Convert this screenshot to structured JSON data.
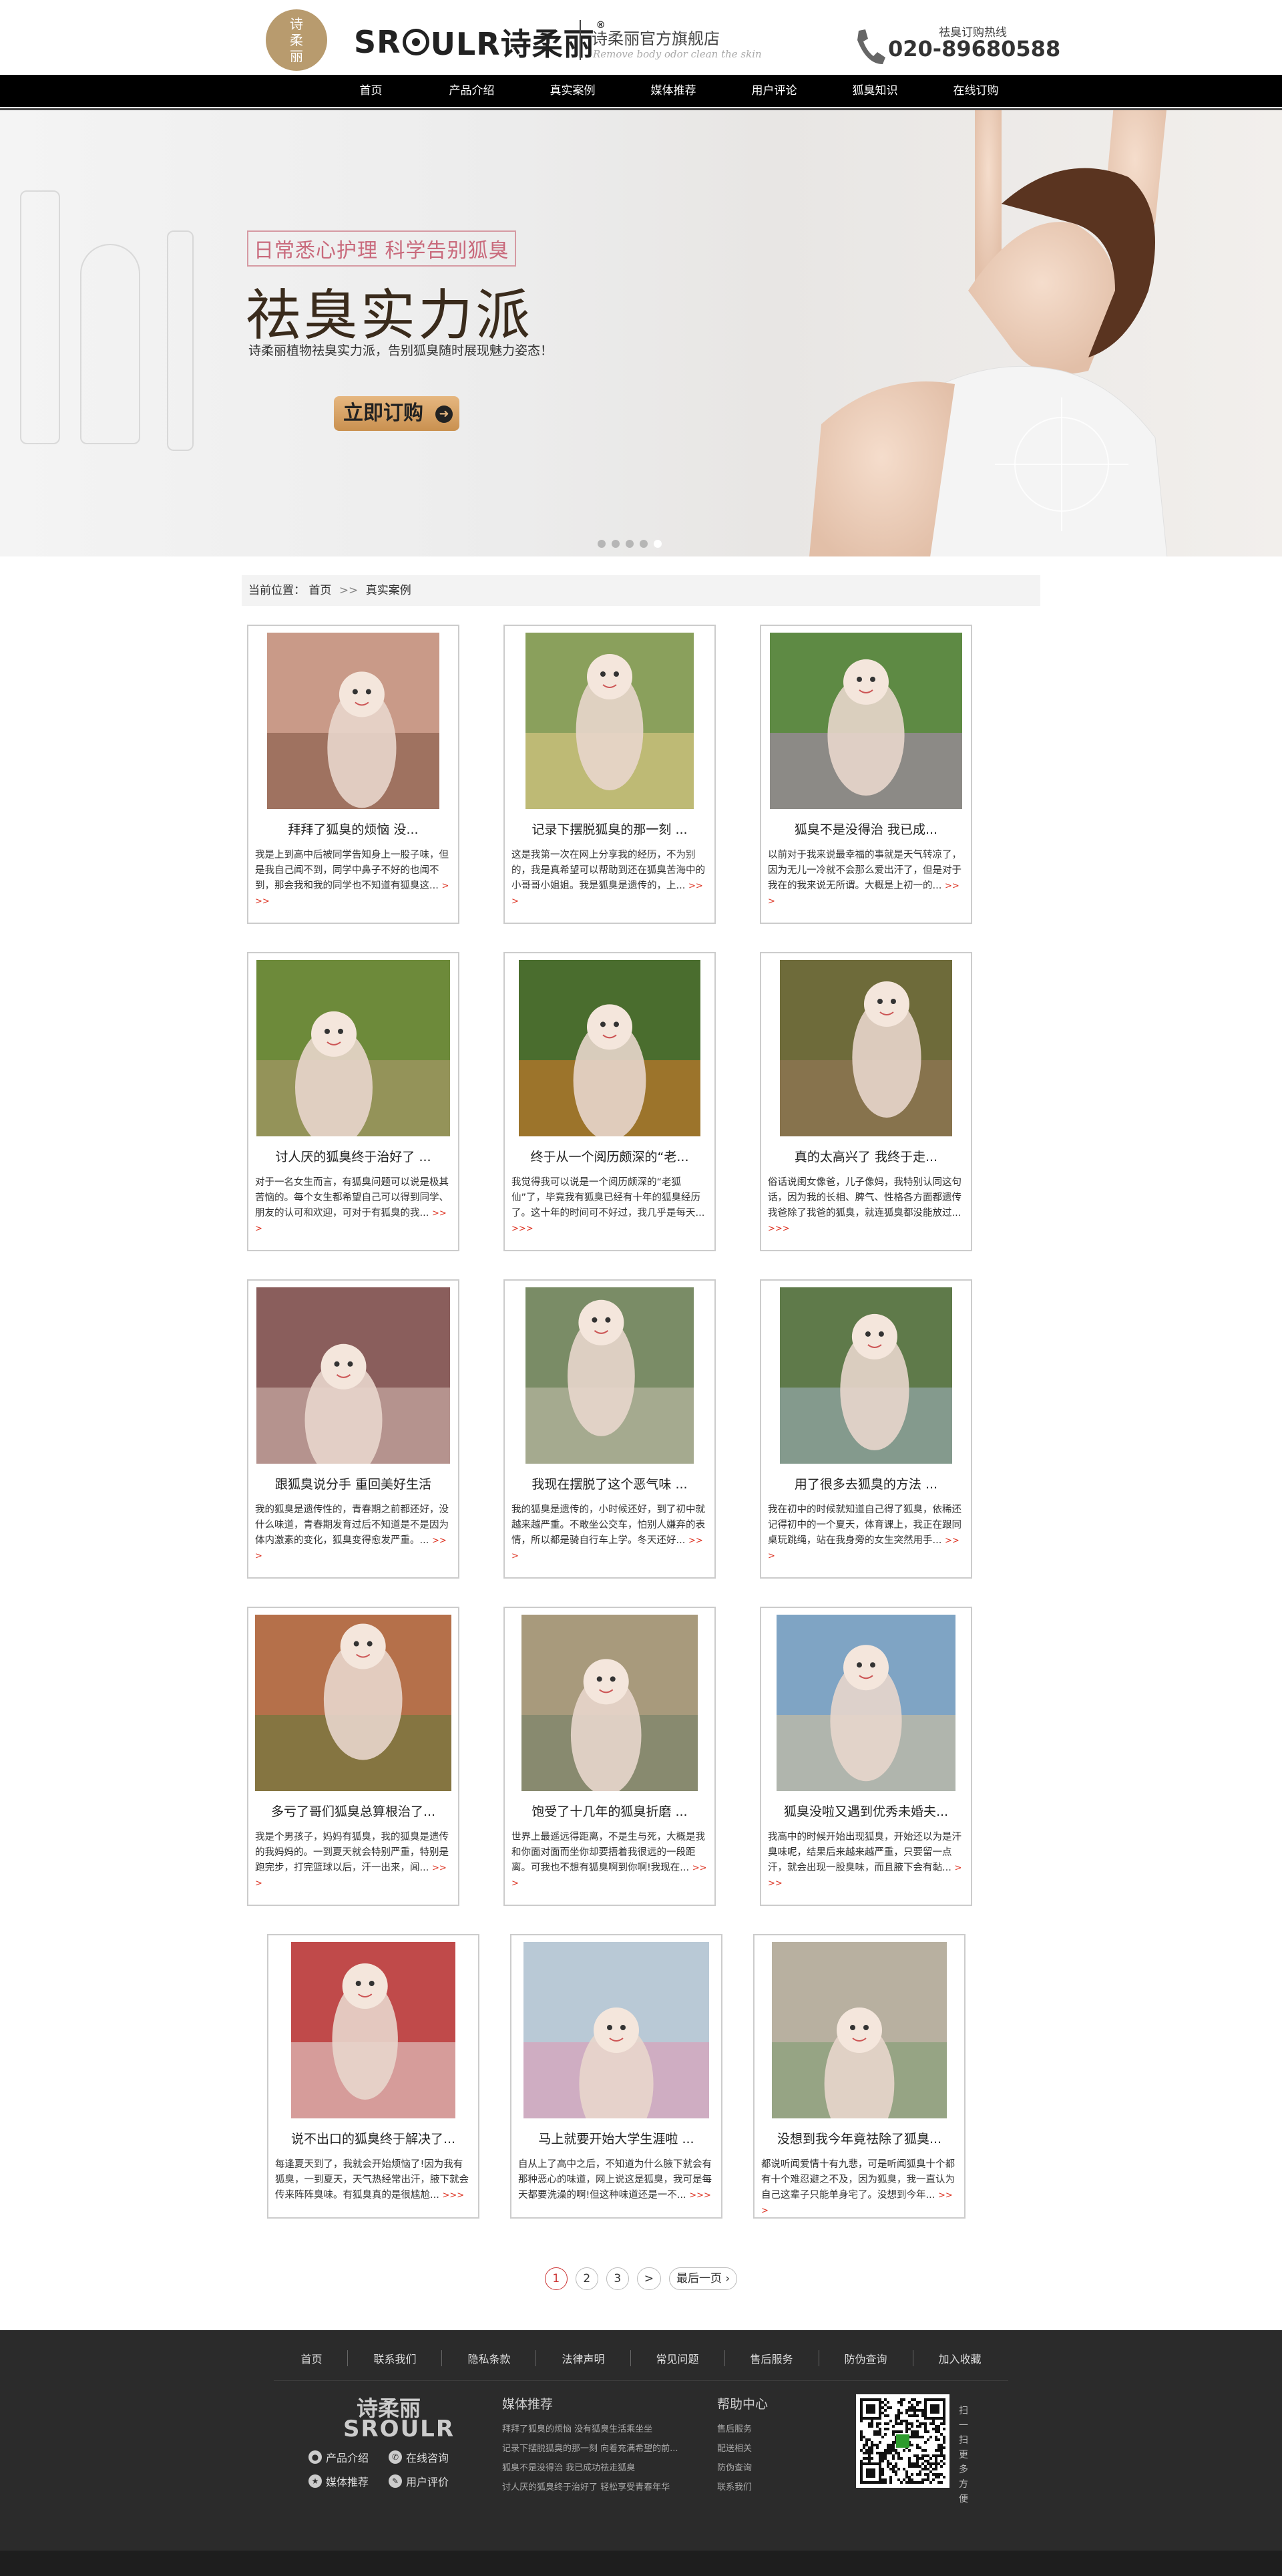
{
  "header": {
    "seal_lines": [
      "诗",
      "柔",
      "丽"
    ],
    "brand_left": "SR",
    "brand_right": "ULR诗柔丽",
    "shop_title": "诗柔丽官方旗舰店",
    "shop_sub": "Remove body odor clean the skin",
    "hotline_label": "祛臭订购热线",
    "hotline_number": "020-89680588"
  },
  "nav": [
    "首页",
    "产品介绍",
    "真实案例",
    "媒体推荐",
    "用户评论",
    "狐臭知识",
    "在线订购"
  ],
  "banner": {
    "tag": "日常悉心护理 科学告别狐臭",
    "headline": "祛臭实力派",
    "desc": "诗柔丽植物祛臭实力派，告别狐臭随时展现魅力姿态！",
    "order_label": "立即订购",
    "slides": 5,
    "active_slide": 5
  },
  "breadcrumb": {
    "label": "当前位置：",
    "home": "首页",
    "sep": ">>",
    "current": "真实案例"
  },
  "cards": [
    {
      "title": "拜拜了狐臭的烦恼 没...",
      "excerpt": "我是上到高中后被同学告知身上一股子味，但是我自己闻不到，同学中鼻子不好的也闻不到，那会我和我的同学也不知道有狐臭这...",
      "more": ">>>"
    },
    {
      "title": "记录下摆脱狐臭的那一刻 ...",
      "excerpt": "这是我第一次在网上分享我的经历，不为别的，我是真希望可以帮助到还在狐臭苦海中的小哥哥小姐姐。我是狐臭是遗传的，上...",
      "more": ">>>"
    },
    {
      "title": "狐臭不是没得治 我已成...",
      "excerpt": "以前对于我来说最幸福的事就是天气转凉了，因为无儿一冷就不会那么爱出汗了，但是对于我在的我来说无所谓。大概是上初一的...",
      "more": ">>>"
    },
    {
      "title": "讨人厌的狐臭终于治好了 ...",
      "excerpt": "对于一名女生而言，有狐臭问题可以说是极其苦恼的。每个女生都希望自己可以得到同学、朋友的认可和欢迎，可对于有狐臭的我...",
      "more": ">>>"
    },
    {
      "title": "终于从一个阅历颇深的“老...",
      "excerpt": "我觉得我可以说是一个阅历颇深的“老狐仙”了，毕竟我有狐臭已经有十年的狐臭经历了。这十年的时间可不好过，我几乎是每天...",
      "more": ">>>"
    },
    {
      "title": "真的太高兴了 我终于走...",
      "excerpt": "俗话说闺女像爸，儿子像妈，我特别认同这句话，因为我的长相、脾气、性格各方面都遗传我爸除了我爸的狐臭，就连狐臭都没能放过...",
      "more": ">>>"
    },
    {
      "title": "跟狐臭说分手 重回美好生活",
      "excerpt": "我的狐臭是遗传性的，青春期之前都还好，没什么味道，青春期发育过后不知道是不是因为体内激素的变化，狐臭变得愈发严重。...",
      "more": ">>>"
    },
    {
      "title": "我现在摆脱了这个恶气味 ...",
      "excerpt": "我的狐臭是遗传的，小时候还好，到了初中就越来越严重。不敢坐公交车，怕别人嫌弃的表情，所以都是骑自行车上学。冬天还好...",
      "more": ">>>"
    },
    {
      "title": "用了很多去狐臭的方法 ...",
      "excerpt": "我在初中的时候就知道自己得了狐臭，依稀还记得初中的一个夏天，体育课上，我正在跟同桌玩跳绳，站在我身旁的女生突然用手...",
      "more": ">>>"
    },
    {
      "title": "多亏了哥们狐臭总算根治了...",
      "excerpt": "我是个男孩子，妈妈有狐臭，我的狐臭是遗传的我妈妈的。一到夏天就会特别严重，特别是跑完步，打完篮球以后，汗一出来，闻...",
      "more": ">>>"
    },
    {
      "title": "饱受了十几年的狐臭折磨 ...",
      "excerpt": "世界上最遥远得距离，不是生与死，大概是我和你面对面而坐你却要捂着我很远的一段距离。可我也不想有狐臭啊到你啊!我现在...",
      "more": ">>>"
    },
    {
      "title": "狐臭没啦又遇到优秀未婚夫...",
      "excerpt": "我高中的时候开始出现狐臭，开始还以为是汗臭味呢，结果后来越来越严重，只要留一点汗，就会出现一股臭味，而且腋下会有黏...",
      "more": ">>>"
    },
    {
      "title": "说不出口的狐臭终于解决了...",
      "excerpt": "每逢夏天到了，我就会开始烦恼了!因为我有狐臭，一到夏天，天气热经常出汗，腋下就会传来阵阵臭味。有狐臭真的是很尴尬...",
      "more": ">>>"
    },
    {
      "title": "马上就要开始大学生涯啦 ...",
      "excerpt": "自从上了高中之后，不知道为什么腋下就会有那种恶心的味道，网上说这是狐臭，我可是每天都要洗澡的啊!但这种味道还是一不...",
      "more": ">>>"
    },
    {
      "title": "没想到我今年竟祛除了狐臭...",
      "excerpt": "都说听闻爱情十有九悲，可是听闻狐臭十个都有十个难忍避之不及，因为狐臭，我一直认为自己这辈子只能单身宅了。没想到今年...",
      "more": ">>>"
    }
  ],
  "pager": [
    "1",
    "2",
    "3",
    ">",
    "最后一页 ›"
  ],
  "pager_active": "1",
  "footer": {
    "links": [
      "首页",
      "联系我们",
      "隐私条款",
      "法律声明",
      "常见问题",
      "售后服务",
      "防伪查询",
      "加入收藏"
    ],
    "logo_cn": "诗柔丽",
    "logo_en": "SROULR",
    "quick": [
      {
        "icon": "product-icon",
        "label": "产品介绍"
      },
      {
        "icon": "consult-icon",
        "label": "在线咨询"
      },
      {
        "icon": "media-icon",
        "label": "媒体推荐"
      },
      {
        "icon": "review-icon",
        "label": "用户评价"
      }
    ],
    "media_title": "媒体推荐",
    "media_list": [
      "拜拜了狐臭的烦恼 没有狐臭生活乘坐坐",
      "记录下摆脱狐臭的那一刻 向着充满希望的前...",
      "狐臭不是没得治 我已成功祛走狐臭",
      "讨人厌的狐臭终于治好了 轻松享受青春年华"
    ],
    "help_title": "帮助中心",
    "help_list": [
      "售后服务",
      "配送相关",
      "防伪查询",
      "联系我们"
    ],
    "qr_text": "扫一扫 更多方便"
  },
  "colors": {
    "nav_bg": "#000000",
    "accent_gold": "#b89b6e",
    "more_red": "#dd3322",
    "footer_bg": "#2b2b2b"
  }
}
